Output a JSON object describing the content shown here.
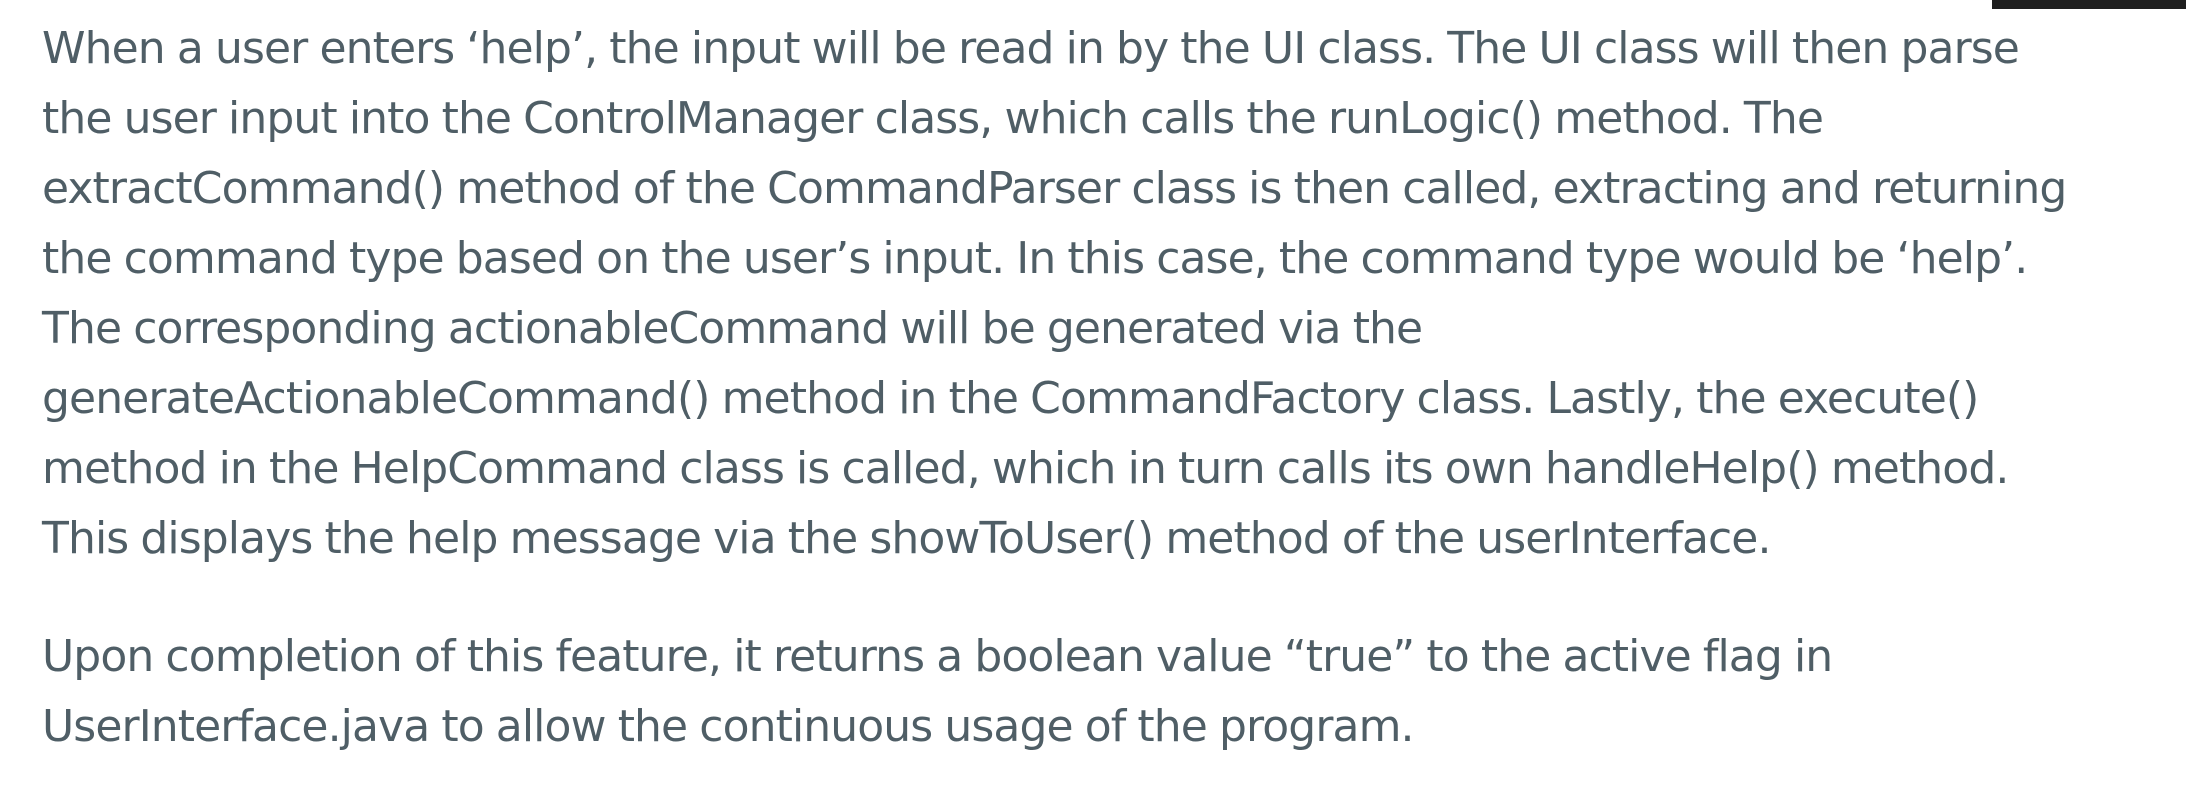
{
  "document": {
    "paragraphs": [
      {
        "lines": [
          "When a user enters ‘help’, the input will be read in by the UI class. The UI class will then parse",
          "the user input into the ControlManager class, which calls the runLogic() method. The",
          "extractCommand() method of the CommandParser class is then called, extracting and returning",
          "the command type based on the user’s input. In this case, the command type would be ‘help’.",
          "The corresponding actionableCommand will be generated via the",
          "generateActionableCommand() method in the CommandFactory class. Lastly, the execute()",
          "method in the HelpCommand class is called, which in turn calls its own handleHelp() method.",
          "This displays the help message via the showToUser() method of the userInterface."
        ]
      },
      {
        "lines": [
          "Upon completion of this feature, it returns a boolean value “true” to the active flag in",
          "UserInterface.java to allow the continuous usage of the program."
        ]
      }
    ]
  }
}
